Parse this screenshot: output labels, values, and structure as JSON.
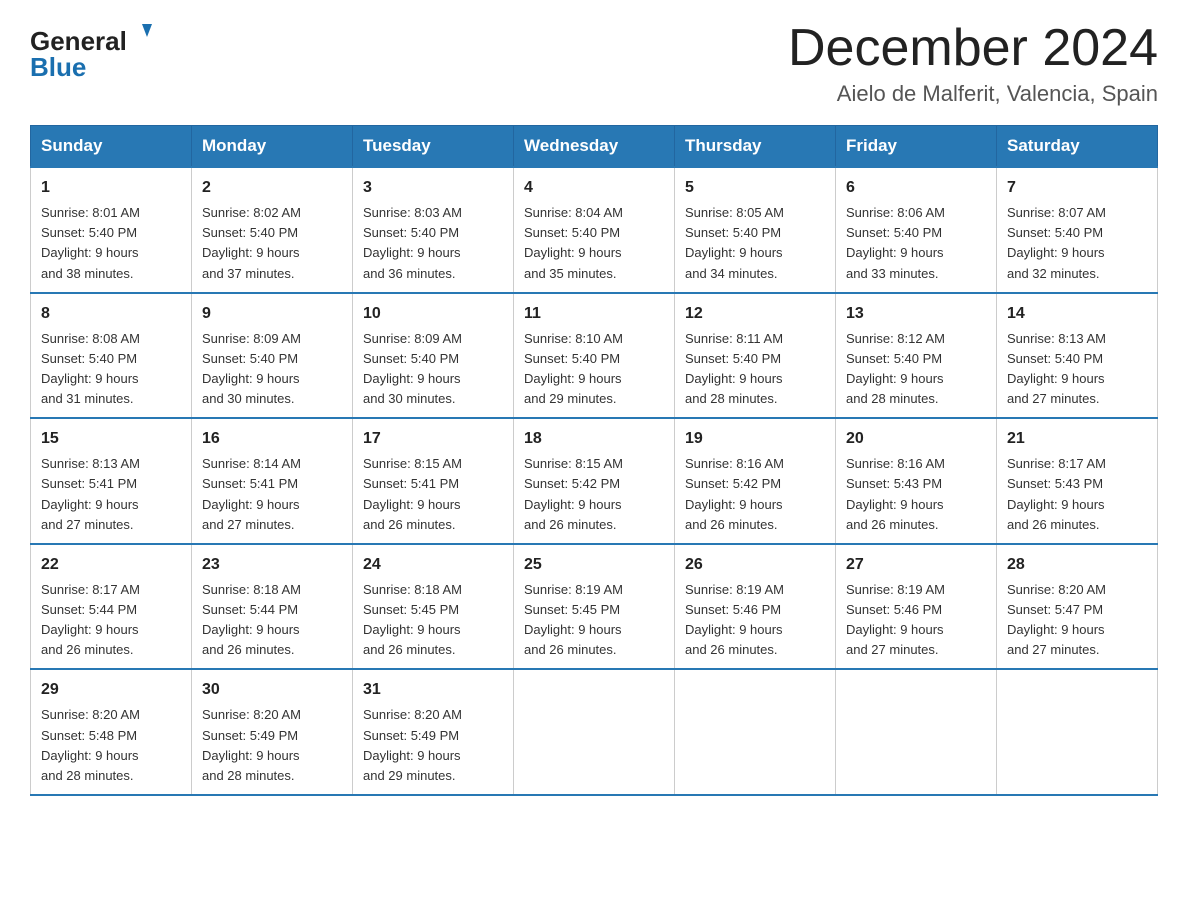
{
  "header": {
    "month_year": "December 2024",
    "location": "Aielo de Malferit, Valencia, Spain",
    "logo_general": "General",
    "logo_blue": "Blue"
  },
  "days_of_week": [
    "Sunday",
    "Monday",
    "Tuesday",
    "Wednesday",
    "Thursday",
    "Friday",
    "Saturday"
  ],
  "weeks": [
    [
      {
        "day": "1",
        "sunrise": "8:01 AM",
        "sunset": "5:40 PM",
        "daylight": "9 hours and 38 minutes."
      },
      {
        "day": "2",
        "sunrise": "8:02 AM",
        "sunset": "5:40 PM",
        "daylight": "9 hours and 37 minutes."
      },
      {
        "day": "3",
        "sunrise": "8:03 AM",
        "sunset": "5:40 PM",
        "daylight": "9 hours and 36 minutes."
      },
      {
        "day": "4",
        "sunrise": "8:04 AM",
        "sunset": "5:40 PM",
        "daylight": "9 hours and 35 minutes."
      },
      {
        "day": "5",
        "sunrise": "8:05 AM",
        "sunset": "5:40 PM",
        "daylight": "9 hours and 34 minutes."
      },
      {
        "day": "6",
        "sunrise": "8:06 AM",
        "sunset": "5:40 PM",
        "daylight": "9 hours and 33 minutes."
      },
      {
        "day": "7",
        "sunrise": "8:07 AM",
        "sunset": "5:40 PM",
        "daylight": "9 hours and 32 minutes."
      }
    ],
    [
      {
        "day": "8",
        "sunrise": "8:08 AM",
        "sunset": "5:40 PM",
        "daylight": "9 hours and 31 minutes."
      },
      {
        "day": "9",
        "sunrise": "8:09 AM",
        "sunset": "5:40 PM",
        "daylight": "9 hours and 30 minutes."
      },
      {
        "day": "10",
        "sunrise": "8:09 AM",
        "sunset": "5:40 PM",
        "daylight": "9 hours and 30 minutes."
      },
      {
        "day": "11",
        "sunrise": "8:10 AM",
        "sunset": "5:40 PM",
        "daylight": "9 hours and 29 minutes."
      },
      {
        "day": "12",
        "sunrise": "8:11 AM",
        "sunset": "5:40 PM",
        "daylight": "9 hours and 28 minutes."
      },
      {
        "day": "13",
        "sunrise": "8:12 AM",
        "sunset": "5:40 PM",
        "daylight": "9 hours and 28 minutes."
      },
      {
        "day": "14",
        "sunrise": "8:13 AM",
        "sunset": "5:40 PM",
        "daylight": "9 hours and 27 minutes."
      }
    ],
    [
      {
        "day": "15",
        "sunrise": "8:13 AM",
        "sunset": "5:41 PM",
        "daylight": "9 hours and 27 minutes."
      },
      {
        "day": "16",
        "sunrise": "8:14 AM",
        "sunset": "5:41 PM",
        "daylight": "9 hours and 27 minutes."
      },
      {
        "day": "17",
        "sunrise": "8:15 AM",
        "sunset": "5:41 PM",
        "daylight": "9 hours and 26 minutes."
      },
      {
        "day": "18",
        "sunrise": "8:15 AM",
        "sunset": "5:42 PM",
        "daylight": "9 hours and 26 minutes."
      },
      {
        "day": "19",
        "sunrise": "8:16 AM",
        "sunset": "5:42 PM",
        "daylight": "9 hours and 26 minutes."
      },
      {
        "day": "20",
        "sunrise": "8:16 AM",
        "sunset": "5:43 PM",
        "daylight": "9 hours and 26 minutes."
      },
      {
        "day": "21",
        "sunrise": "8:17 AM",
        "sunset": "5:43 PM",
        "daylight": "9 hours and 26 minutes."
      }
    ],
    [
      {
        "day": "22",
        "sunrise": "8:17 AM",
        "sunset": "5:44 PM",
        "daylight": "9 hours and 26 minutes."
      },
      {
        "day": "23",
        "sunrise": "8:18 AM",
        "sunset": "5:44 PM",
        "daylight": "9 hours and 26 minutes."
      },
      {
        "day": "24",
        "sunrise": "8:18 AM",
        "sunset": "5:45 PM",
        "daylight": "9 hours and 26 minutes."
      },
      {
        "day": "25",
        "sunrise": "8:19 AM",
        "sunset": "5:45 PM",
        "daylight": "9 hours and 26 minutes."
      },
      {
        "day": "26",
        "sunrise": "8:19 AM",
        "sunset": "5:46 PM",
        "daylight": "9 hours and 26 minutes."
      },
      {
        "day": "27",
        "sunrise": "8:19 AM",
        "sunset": "5:46 PM",
        "daylight": "9 hours and 27 minutes."
      },
      {
        "day": "28",
        "sunrise": "8:20 AM",
        "sunset": "5:47 PM",
        "daylight": "9 hours and 27 minutes."
      }
    ],
    [
      {
        "day": "29",
        "sunrise": "8:20 AM",
        "sunset": "5:48 PM",
        "daylight": "9 hours and 28 minutes."
      },
      {
        "day": "30",
        "sunrise": "8:20 AM",
        "sunset": "5:49 PM",
        "daylight": "9 hours and 28 minutes."
      },
      {
        "day": "31",
        "sunrise": "8:20 AM",
        "sunset": "5:49 PM",
        "daylight": "9 hours and 29 minutes."
      },
      null,
      null,
      null,
      null
    ]
  ],
  "labels": {
    "sunrise": "Sunrise:",
    "sunset": "Sunset:",
    "daylight": "Daylight:"
  }
}
